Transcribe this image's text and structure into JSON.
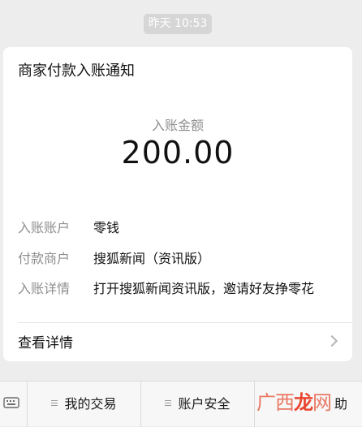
{
  "timestamp": "昨天 10:53",
  "card": {
    "title": "商家付款入账通知",
    "amount_label": "入账金额",
    "amount": "200.00",
    "rows": [
      {
        "label": "入账账户",
        "value": "零钱"
      },
      {
        "label": "付款商户",
        "value": "搜狐新闻（资讯版）"
      },
      {
        "label": "入账详情",
        "value": "打开搜狐新闻资讯版，邀请好友挣零花"
      }
    ],
    "details_link": "查看详情"
  },
  "bottom_bar": {
    "tabs": [
      "我的交易",
      "账户安全",
      "助"
    ]
  },
  "watermark": {
    "part1": "广西",
    "part2": "龙",
    "part3": "网"
  },
  "colors": {
    "background": "#ededed",
    "card": "#ffffff",
    "watermark": "#e8462f"
  },
  "icons": {
    "keyboard": "keyboard-icon",
    "menu": "menu-icon",
    "chevron": "chevron-right-icon"
  }
}
